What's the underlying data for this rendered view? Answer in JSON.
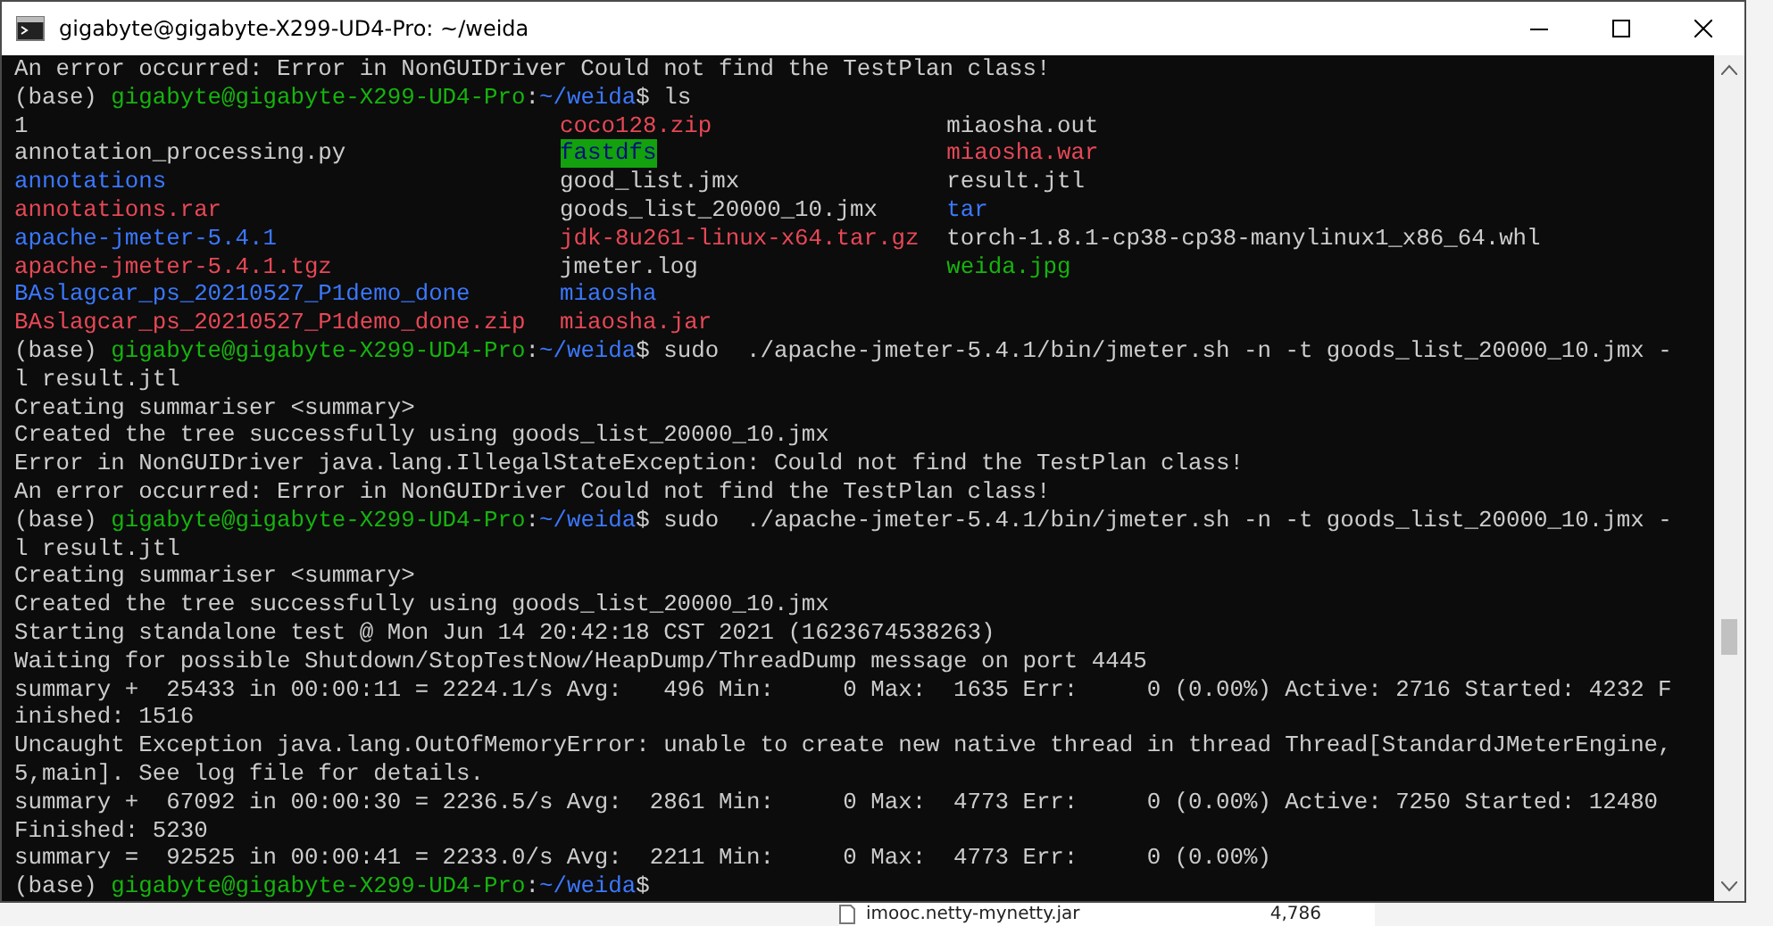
{
  "window": {
    "title": "gigabyte@gigabyte-X299-UD4-Pro: ~/weida"
  },
  "terminal": {
    "blocks": [
      {
        "kind": "lines",
        "lines": [
          [
            {
              "kind": "plain",
              "text": "An error occurred: Error in NonGUIDriver Could not find the TestPlan class!"
            }
          ],
          [
            {
              "kind": "plain",
              "text": "(base) "
            },
            {
              "kind": "user",
              "text": "gigabyte@gigabyte-X299-UD4-Pro"
            },
            {
              "kind": "plain",
              "text": ":"
            },
            {
              "kind": "path",
              "text": "~/weida"
            },
            {
              "kind": "plain",
              "text": "$ ls"
            }
          ]
        ]
      },
      {
        "kind": "listing",
        "rows": [
          [
            {
              "kind": "file",
              "text": "1"
            },
            {
              "kind": "archive",
              "text": "coco128.zip"
            },
            {
              "kind": "file",
              "text": "miaosha.out"
            }
          ],
          [
            {
              "kind": "file",
              "text": "annotation_processing.py"
            },
            {
              "kind": "shared",
              "text": "fastdfs"
            },
            {
              "kind": "archive",
              "text": "miaosha.war"
            }
          ],
          [
            {
              "kind": "dir",
              "text": "annotations"
            },
            {
              "kind": "file",
              "text": "good_list.jmx"
            },
            {
              "kind": "file",
              "text": "result.jtl"
            }
          ],
          [
            {
              "kind": "archive",
              "text": "annotations.rar"
            },
            {
              "kind": "file",
              "text": "goods_list_20000_10.jmx"
            },
            {
              "kind": "dir",
              "text": "tar"
            }
          ],
          [
            {
              "kind": "dir",
              "text": "apache-jmeter-5.4.1"
            },
            {
              "kind": "archive",
              "text": "jdk-8u261-linux-x64.tar.gz"
            },
            {
              "kind": "file",
              "text": "torch-1.8.1-cp38-cp38-manylinux1_x86_64.whl"
            }
          ],
          [
            {
              "kind": "archive",
              "text": "apache-jmeter-5.4.1.tgz"
            },
            {
              "kind": "file",
              "text": "jmeter.log"
            },
            {
              "kind": "image",
              "text": "weida.jpg"
            }
          ],
          [
            {
              "kind": "dir",
              "text": "BAslagcar_ps_20210527_P1demo_done"
            },
            {
              "kind": "dir",
              "text": "miaosha"
            }
          ],
          [
            {
              "kind": "archive",
              "text": "BAslagcar_ps_20210527_P1demo_done.zip"
            },
            {
              "kind": "archive",
              "text": "miaosha.jar"
            }
          ]
        ]
      },
      {
        "kind": "lines",
        "lines": [
          [
            {
              "kind": "plain",
              "text": "(base) "
            },
            {
              "kind": "user",
              "text": "gigabyte@gigabyte-X299-UD4-Pro"
            },
            {
              "kind": "plain",
              "text": ":"
            },
            {
              "kind": "path",
              "text": "~/weida"
            },
            {
              "kind": "plain",
              "text": "$ sudo  ./apache-jmeter-5.4.1/bin/jmeter.sh -n -t goods_list_20000_10.jmx -"
            }
          ],
          [
            {
              "kind": "plain",
              "text": "l result.jtl"
            }
          ],
          [
            {
              "kind": "plain",
              "text": "Creating summariser <summary>"
            }
          ],
          [
            {
              "kind": "plain",
              "text": "Created the tree successfully using goods_list_20000_10.jmx"
            }
          ],
          [
            {
              "kind": "plain",
              "text": "Error in NonGUIDriver java.lang.IllegalStateException: Could not find the TestPlan class!"
            }
          ],
          [
            {
              "kind": "plain",
              "text": "An error occurred: Error in NonGUIDriver Could not find the TestPlan class!"
            }
          ],
          [
            {
              "kind": "plain",
              "text": "(base) "
            },
            {
              "kind": "user",
              "text": "gigabyte@gigabyte-X299-UD4-Pro"
            },
            {
              "kind": "plain",
              "text": ":"
            },
            {
              "kind": "path",
              "text": "~/weida"
            },
            {
              "kind": "plain",
              "text": "$ sudo  ./apache-jmeter-5.4.1/bin/jmeter.sh -n -t goods_list_20000_10.jmx -"
            }
          ],
          [
            {
              "kind": "plain",
              "text": "l result.jtl"
            }
          ],
          [
            {
              "kind": "plain",
              "text": "Creating summariser <summary>"
            }
          ],
          [
            {
              "kind": "plain",
              "text": "Created the tree successfully using goods_list_20000_10.jmx"
            }
          ],
          [
            {
              "kind": "plain",
              "text": "Starting standalone test @ Mon Jun 14 20:42:18 CST 2021 (1623674538263)"
            }
          ],
          [
            {
              "kind": "plain",
              "text": "Waiting for possible Shutdown/StopTestNow/HeapDump/ThreadDump message on port 4445"
            }
          ],
          [
            {
              "kind": "plain",
              "text": "summary +  25433 in 00:00:11 = 2224.1/s Avg:   496 Min:     0 Max:  1635 Err:     0 (0.00%) Active: 2716 Started: 4232 F"
            }
          ],
          [
            {
              "kind": "plain",
              "text": "inished: 1516"
            }
          ],
          [
            {
              "kind": "plain",
              "text": "Uncaught Exception java.lang.OutOfMemoryError: unable to create new native thread in thread Thread[StandardJMeterEngine,"
            }
          ],
          [
            {
              "kind": "plain",
              "text": "5,main]. See log file for details."
            }
          ],
          [
            {
              "kind": "plain",
              "text": "summary +  67092 in 00:00:30 = 2236.5/s Avg:  2861 Min:     0 Max:  4773 Err:     0 (0.00%) Active: 7250 Started: 12480"
            }
          ],
          [
            {
              "kind": "plain",
              "text": "Finished: 5230"
            }
          ],
          [
            {
              "kind": "plain",
              "text": "summary =  92525 in 00:00:41 = 2233.0/s Avg:  2211 Min:     0 Max:  4773 Err:     0 (0.00%)"
            }
          ],
          [
            {
              "kind": "plain",
              "text": "(base) "
            },
            {
              "kind": "user",
              "text": "gigabyte@gigabyte-X299-UD4-Pro"
            },
            {
              "kind": "plain",
              "text": ":"
            },
            {
              "kind": "path",
              "text": "~/weida"
            },
            {
              "kind": "plain",
              "text": "$"
            }
          ]
        ]
      }
    ]
  },
  "background_file": {
    "name": "imooc.netty-mynetty.jar",
    "size": "4,786"
  }
}
